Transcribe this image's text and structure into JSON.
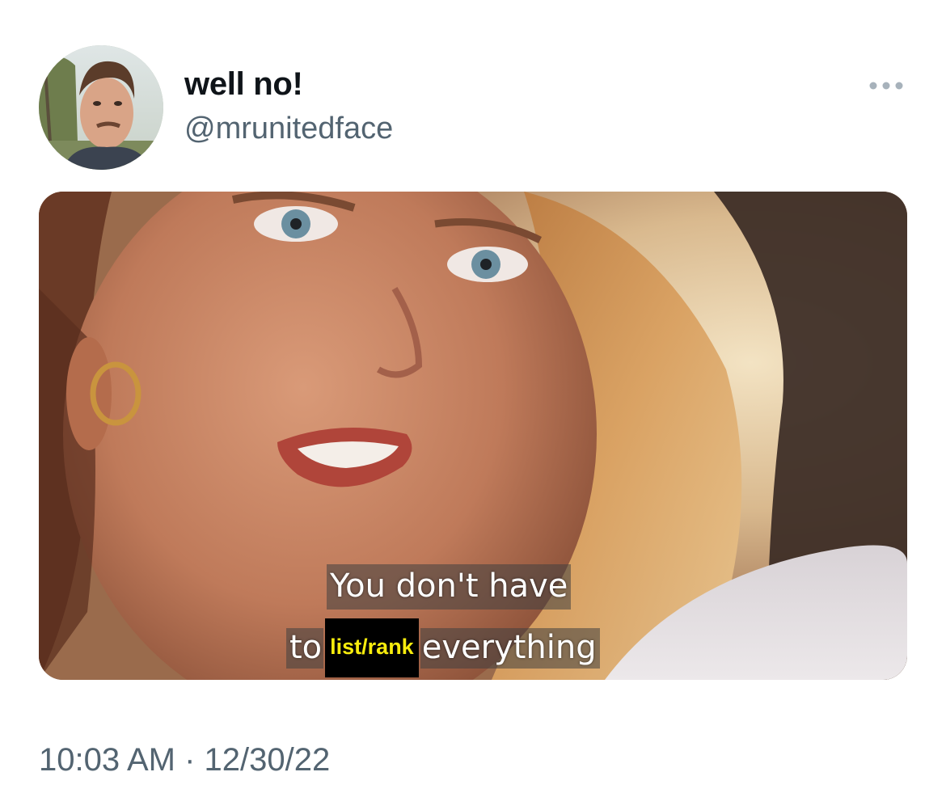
{
  "tweet": {
    "author": {
      "display_name": "well no!",
      "handle": "@mrunitedface"
    },
    "more_icon": "ellipsis-horizontal-icon",
    "media": {
      "subtitle_line1": "You don't have",
      "subtitle_line2_start": "to",
      "subtitle_highlight": "list/rank",
      "subtitle_line2_end": "everything"
    },
    "timestamp": "10:03 AM · 12/30/22"
  },
  "colors": {
    "name": "#0f1419",
    "secondary": "#536471",
    "highlight_text": "#f7ec0d",
    "highlight_bg": "#000000"
  }
}
